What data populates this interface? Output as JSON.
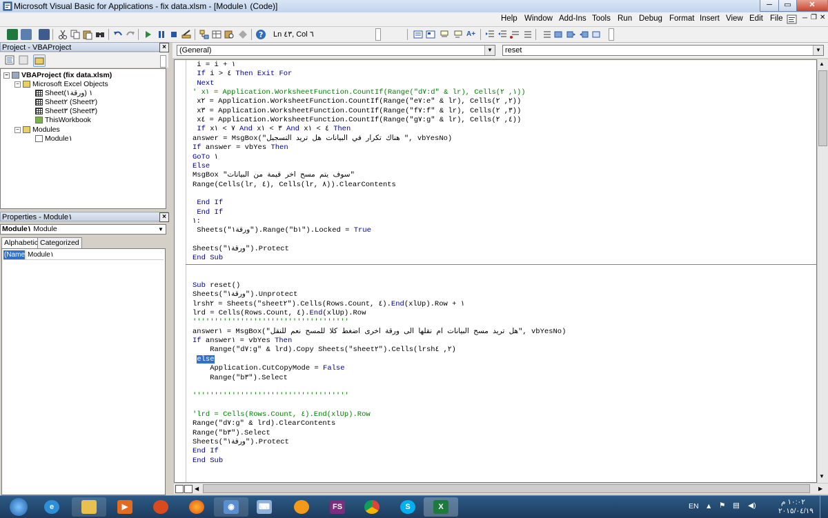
{
  "window": {
    "title": "Microsoft Visual Basic for Applications - fix data.xlsm - [Module١ (Code)]"
  },
  "menu": [
    "Help",
    "Window",
    "Add-Ins",
    "Tools",
    "Run",
    "Debug",
    "Format",
    "Insert",
    "View",
    "Edit",
    "File"
  ],
  "toolbar": {
    "position": "Ln ٤٣, Col ٦"
  },
  "project": {
    "title": "Project - VBAProject",
    "tree": {
      "root": "VBAProject (fix data.xlsm)",
      "objects_folder": "Microsoft Excel Objects",
      "sheets": [
        "Sheet١ (ورقة١)",
        "Sheet٢ (Sheet٢)",
        "Sheet٣ (Sheet٣)"
      ],
      "workbook": "ThisWorkbook",
      "modules_folder": "Modules",
      "module": "Module١"
    }
  },
  "properties": {
    "title": "Properties - Module١",
    "object_name": "Module١",
    "object_type": "Module",
    "tabs": [
      "Alphabetic",
      "Categorized"
    ],
    "row_name": "(Name)",
    "row_value": "Module١"
  },
  "code": {
    "object_combo": "(General)",
    "proc_combo": "reset",
    "lines_top": [
      " i = i + ١",
      " If i > ٤ Then Exit For",
      " Next",
      "' x١ = Application.WorksheetFunction.CountIf(Range(\"d٧:d\" & lr), Cells(١, ٢))",
      " x٢ = Application.WorksheetFunction.CountIf(Range(\"e٧:e\" & lr), Cells(٢, ٢))",
      " x٣ = Application.WorksheetFunction.CountIf(Range(\"f٧:f\" & lr), Cells(٣, ٢))",
      " x٤ = Application.WorksheetFunction.CountIf(Range(\"g٧:g\" & lr), Cells(٤, ٢))",
      " If x٧ > ١ And x٣ > ١ And x٤ > ١ Then",
      "answer = MsgBox(\"هناك تكرار في البيانات هل تريد التسجيل \", vbYesNo)",
      "If answer = vbYes Then",
      "GoTo ١",
      "Else",
      "MsgBox \"سوف يتم مسح اخر قيمة من البيانات\"",
      "Range(Cells(lr, ٤), Cells(lr, ٨)).ClearContents",
      "",
      " End If",
      " End If",
      "١:",
      " Sheets(\"ورقة١\").Range(\"b١\").Locked = True",
      "",
      "Sheets(\"ورقة١\").Protect",
      "End Sub"
    ],
    "lines_bottom": [
      "Sub reset()",
      "Sheets(\"ورقة١\").Unprotect",
      "lrsh٢ = Sheets(\"sheet٢\").Cells(Rows.Count, ٤).End(xlUp).Row + ١",
      "lrd = Cells(Rows.Count, ٤).End(xlUp).Row",
      "''''''''''''''''''''''''''''''''''''",
      "answer١ = MsgBox(\"هل تريد مسح البيانات ام نقلها الى ورقة اخرى اضغط كلا للمسح نعم للنقل\", vbYesNo)",
      "If answer١ = vbYes Then",
      "    Range(\"d٧:g\" & lrd).Copy Sheets(\"sheet٢\").Cells(lrsh٢, ٤)",
      "else",
      "    Application.CutCopyMode = False",
      "    Range(\"b٣\").Select",
      "",
      "''''''''''''''''''''''''''''''''''''",
      "",
      "'lrd = Cells(Rows.Count, ٤).End(xlUp).Row",
      "Range(\"d٧:g\" & lrd).ClearContents",
      "Range(\"b٣\").Select",
      "Sheets(\"ورقة١\").Protect",
      "End If",
      "End Sub"
    ]
  },
  "taskbar": {
    "language": "EN",
    "time": "١٠:٠٢ م",
    "date": "٢٠١٥/٠٤/١٩",
    "apps": [
      "start",
      "ie",
      "explorer",
      "media",
      "mozilla",
      "firefox",
      "outlook",
      "keyboard",
      "vlc",
      "fs",
      "chrome",
      "skype",
      "excel"
    ]
  },
  "colors": {
    "keyword": "#00008b",
    "comment": "#008000",
    "selection": "#3070c8"
  }
}
